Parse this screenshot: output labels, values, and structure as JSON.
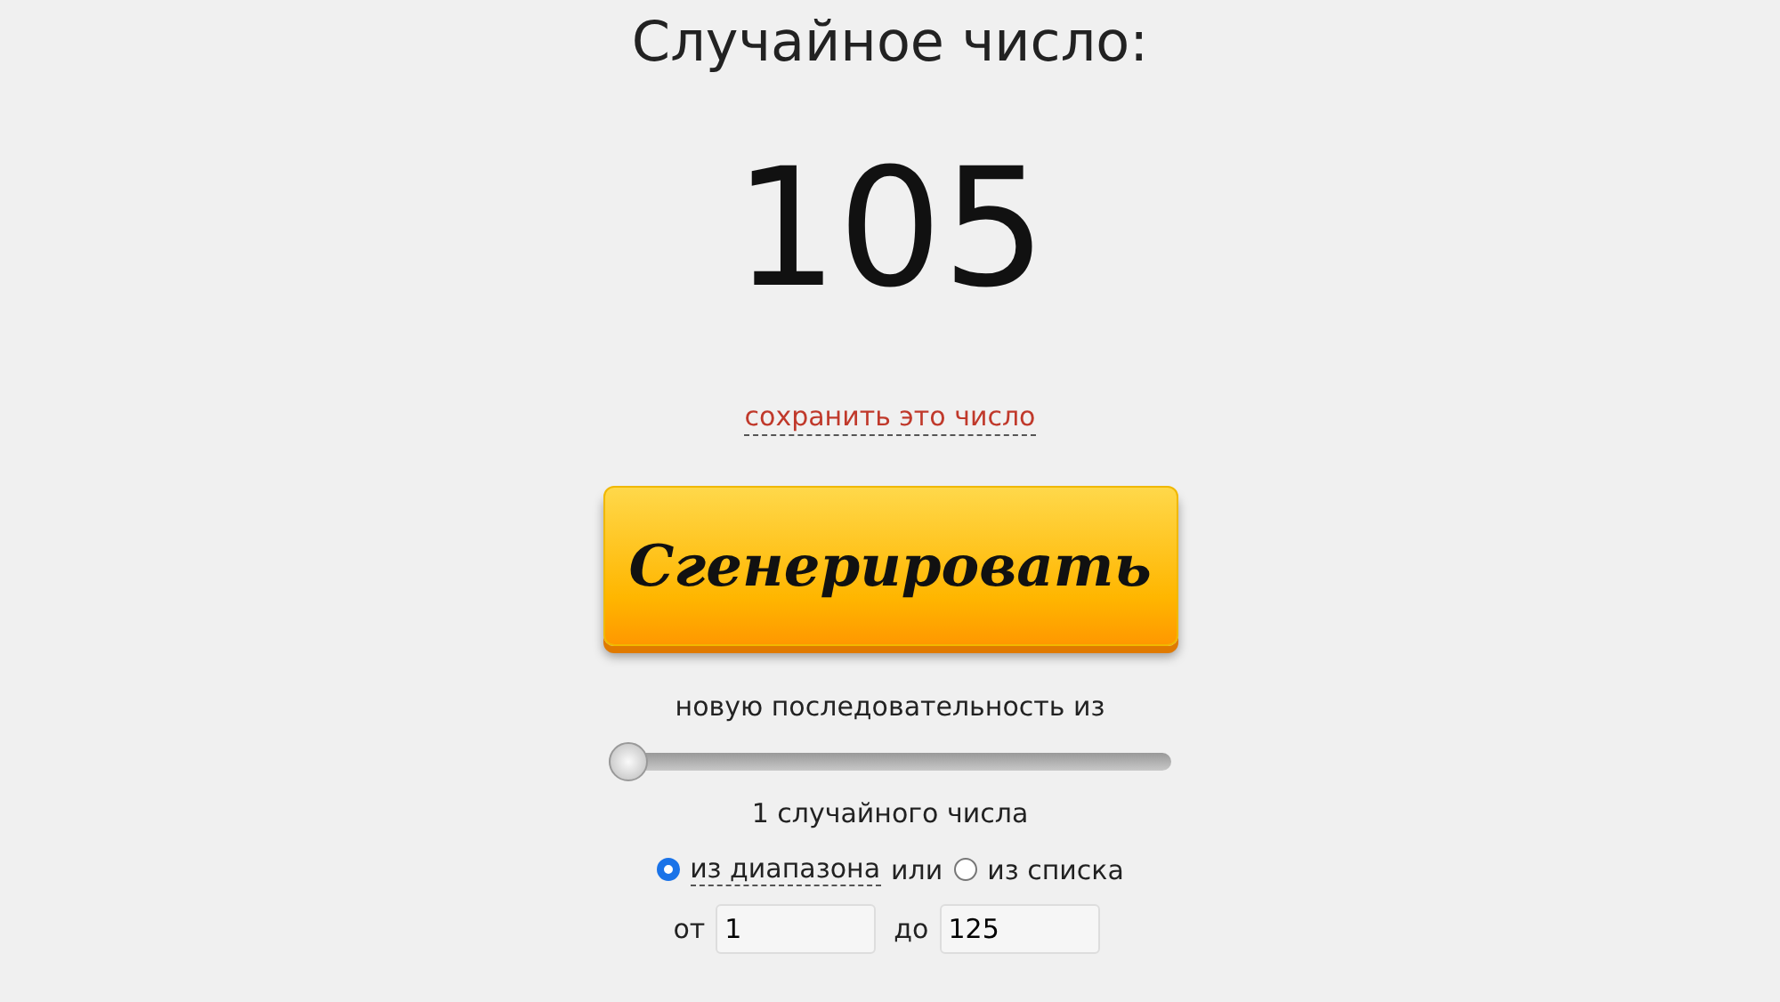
{
  "title": "Случайное число:",
  "number": "105",
  "save_link": "сохранить это число",
  "generate_button": "Сгенерировать",
  "sequence_label": "новую последовательность из",
  "count_slider": {
    "level": 0
  },
  "count_text": "1 случайного числа",
  "source_options": [
    {
      "label": "из диапазона",
      "selected": true
    },
    {
      "label": "из списка",
      "selected": false
    }
  ],
  "or_word": "или",
  "range": {
    "from_label": "от",
    "from_value": "1",
    "to_label": "до",
    "to_value": "125"
  }
}
